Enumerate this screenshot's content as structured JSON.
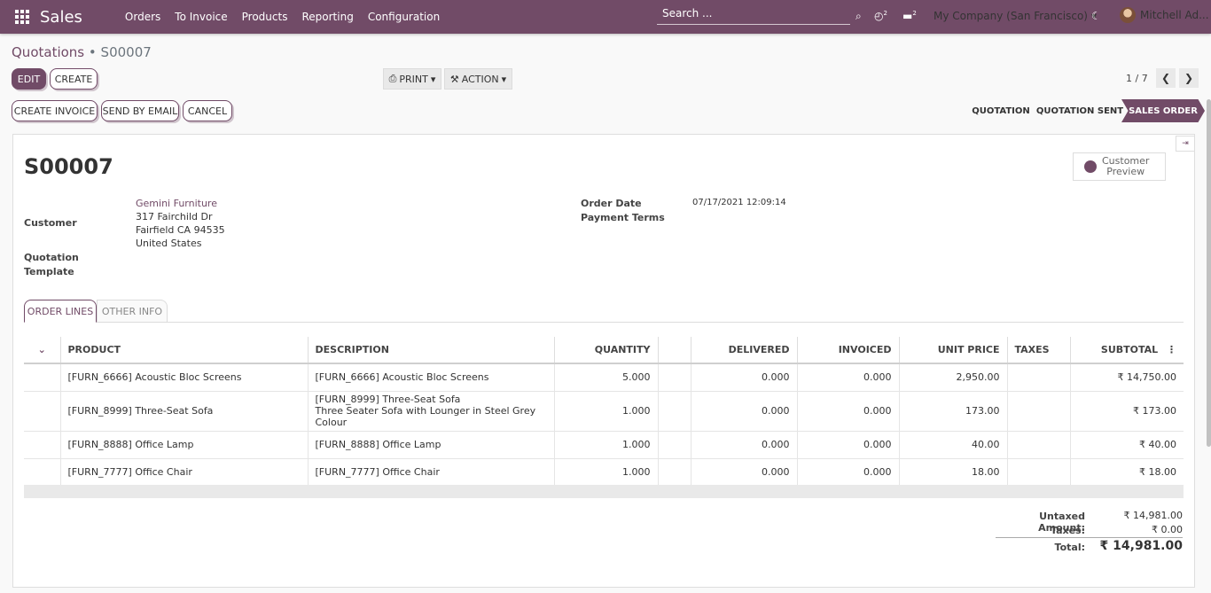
{
  "app": {
    "title": "Sales",
    "menu": [
      "Orders",
      "To Invoice",
      "Products",
      "Reporting",
      "Configuration"
    ],
    "search_placeholder": "Search ...",
    "activity_count": "2",
    "message_count": "2",
    "company": "My Company (San Francisco)",
    "user": "Mitchell Ad..."
  },
  "breadcrumb": {
    "parent": "Quotations",
    "separator": "•",
    "current": "S00007"
  },
  "toolbar": {
    "edit": "EDIT",
    "create": "CREATE",
    "print": "PRINT",
    "action": "ACTION",
    "pager": "1 / 7"
  },
  "actions": {
    "create_invoice": "CREATE INVOICE",
    "send_email": "SEND BY EMAIL",
    "cancel": "CANCEL"
  },
  "statusbar": [
    {
      "label": "QUOTATION",
      "active": false
    },
    {
      "label": "QUOTATION SENT",
      "active": false
    },
    {
      "label": "SALES ORDER",
      "active": true
    }
  ],
  "form": {
    "name": "S00007",
    "preview_button": [
      "Customer",
      "Preview"
    ],
    "customer_label": "Customer",
    "customer_name": "Gemini Furniture",
    "customer_address": [
      "317 Fairchild Dr",
      "Fairfield CA 94535",
      "United States"
    ],
    "template_label": [
      "Quotation",
      "Template"
    ],
    "order_date_label": "Order Date",
    "order_date": "07/17/2021 12:09:14",
    "payment_terms_label": "Payment Terms"
  },
  "tabs": [
    {
      "label": "ORDER LINES",
      "active": true
    },
    {
      "label": "OTHER INFO",
      "active": false
    }
  ],
  "table": {
    "headers": [
      "PRODUCT",
      "DESCRIPTION",
      "QUANTITY",
      "DELIVERED",
      "INVOICED",
      "UNIT PRICE",
      "TAXES",
      "SUBTOTAL"
    ],
    "rows": [
      {
        "product": "[FURN_6666] Acoustic Bloc Screens",
        "description": [
          "[FURN_6666] Acoustic Bloc Screens"
        ],
        "quantity": "5.000",
        "delivered": "0.000",
        "invoiced": "0.000",
        "unit_price": "2,950.00",
        "taxes": "",
        "subtotal": "₹ 14,750.00"
      },
      {
        "product": "[FURN_8999] Three-Seat Sofa",
        "description": [
          "[FURN_8999] Three-Seat Sofa",
          "Three Seater Sofa with Lounger in Steel Grey Colour"
        ],
        "quantity": "1.000",
        "delivered": "0.000",
        "invoiced": "0.000",
        "unit_price": "173.00",
        "taxes": "",
        "subtotal": "₹ 173.00"
      },
      {
        "product": "[FURN_8888] Office Lamp",
        "description": [
          "[FURN_8888] Office Lamp"
        ],
        "quantity": "1.000",
        "delivered": "0.000",
        "invoiced": "0.000",
        "unit_price": "40.00",
        "taxes": "",
        "subtotal": "₹ 40.00"
      },
      {
        "product": "[FURN_7777] Office Chair",
        "description": [
          "[FURN_7777] Office Chair"
        ],
        "quantity": "1.000",
        "delivered": "0.000",
        "invoiced": "0.000",
        "unit_price": "18.00",
        "taxes": "",
        "subtotal": "₹ 18.00"
      }
    ]
  },
  "totals": {
    "untaxed_label": "Untaxed Amount:",
    "untaxed_value": "₹ 14,981.00",
    "taxes_label": "Taxes:",
    "taxes_value": "₹ 0.00",
    "total_label": "Total:",
    "total_value": "₹ 14,981.00"
  },
  "colors": {
    "brand": "#714b67"
  }
}
